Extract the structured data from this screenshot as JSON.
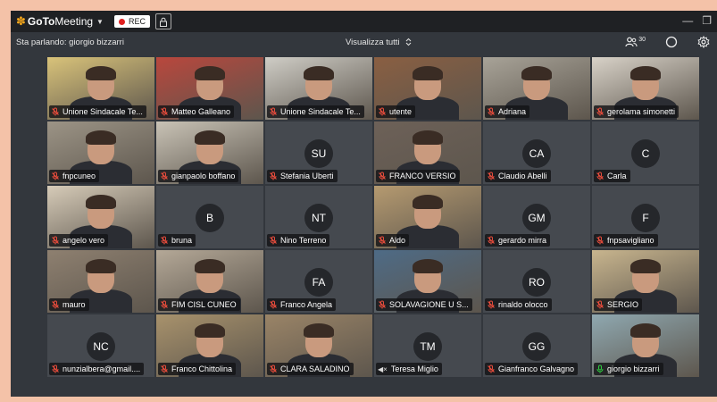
{
  "app": {
    "brand_goto": "GoTo",
    "brand_meeting": "Meeting",
    "rec_label": "REC"
  },
  "subbar": {
    "speaking": "Sta parlando: giorgio bizzarri",
    "view_all": "Visualizza tutti",
    "participant_count": "30"
  },
  "colors": {
    "muted": "#e74c3c",
    "active_mic": "#2ecc40",
    "brand": "#f7a81b",
    "rec": "#e02020"
  },
  "tiles": [
    {
      "name": "Unione Sindacale Te...",
      "type": "video",
      "mic": "muted",
      "bg": "#d9c37a"
    },
    {
      "name": "Matteo Galleano",
      "type": "video",
      "mic": "muted",
      "bg": "#b9473d"
    },
    {
      "name": "Unione Sindacale Te...",
      "type": "video",
      "mic": "muted",
      "bg": "#cfcdc6"
    },
    {
      "name": "utente",
      "type": "video",
      "mic": "muted",
      "bg": "#8a5f42"
    },
    {
      "name": "Adriana",
      "type": "video",
      "mic": "muted",
      "bg": "#a8a398"
    },
    {
      "name": "gerolama simonetti",
      "type": "video",
      "mic": "muted",
      "bg": "#d8d2c8"
    },
    {
      "name": "fnpcuneo",
      "type": "video",
      "mic": "muted",
      "bg": "#9c9486"
    },
    {
      "name": "gianpaolo boffano",
      "type": "video",
      "mic": "muted",
      "bg": "#c9c3b6"
    },
    {
      "name": "Stefania Uberti",
      "type": "avatar",
      "initials": "SU",
      "mic": "muted"
    },
    {
      "name": "FRANCO VERSIO",
      "type": "video",
      "mic": "muted",
      "bg": "#6d6158"
    },
    {
      "name": "Claudio Abelli",
      "type": "avatar",
      "initials": "CA",
      "mic": "muted"
    },
    {
      "name": "Carla",
      "type": "avatar",
      "initials": "C",
      "mic": "muted"
    },
    {
      "name": "angelo vero",
      "type": "video",
      "mic": "muted",
      "bg": "#d6cbb8"
    },
    {
      "name": "bruna",
      "type": "avatar",
      "initials": "B",
      "mic": "muted"
    },
    {
      "name": "Nino Terreno",
      "type": "avatar",
      "initials": "NT",
      "mic": "muted"
    },
    {
      "name": "Aldo",
      "type": "video",
      "mic": "muted",
      "bg": "#b59a70"
    },
    {
      "name": "gerardo mirra",
      "type": "avatar",
      "initials": "GM",
      "mic": "muted"
    },
    {
      "name": "fnpsavigliano",
      "type": "avatar",
      "initials": "F",
      "mic": "muted"
    },
    {
      "name": "mauro",
      "type": "video",
      "mic": "muted",
      "bg": "#8e8070"
    },
    {
      "name": "FIM CISL CUNEO",
      "type": "video",
      "mic": "muted",
      "bg": "#b4a897"
    },
    {
      "name": "Franco Angela",
      "type": "avatar",
      "initials": "FA",
      "mic": "muted"
    },
    {
      "name": "SOLAVAGIONE U S...",
      "type": "video",
      "mic": "muted",
      "bg": "#4e6b86"
    },
    {
      "name": "rinaldo olocco",
      "type": "avatar",
      "initials": "RO",
      "mic": "muted"
    },
    {
      "name": "SERGIO",
      "type": "video",
      "mic": "muted",
      "bg": "#c8b58e"
    },
    {
      "name": "nunzialbera@gmail....",
      "type": "avatar",
      "initials": "NC",
      "mic": "muted"
    },
    {
      "name": "Franco Chittolina",
      "type": "video",
      "mic": "muted",
      "bg": "#a8926c"
    },
    {
      "name": "CLARA SALADINO",
      "type": "video",
      "mic": "muted",
      "bg": "#9a8467"
    },
    {
      "name": "Teresa Miglio",
      "type": "avatar",
      "initials": "TM",
      "mic": "speaker"
    },
    {
      "name": "Gianfranco Galvagno",
      "type": "avatar",
      "initials": "GG",
      "mic": "muted"
    },
    {
      "name": "giorgio bizzarri",
      "type": "video",
      "mic": "active",
      "bg": "#8fa8b0"
    }
  ]
}
